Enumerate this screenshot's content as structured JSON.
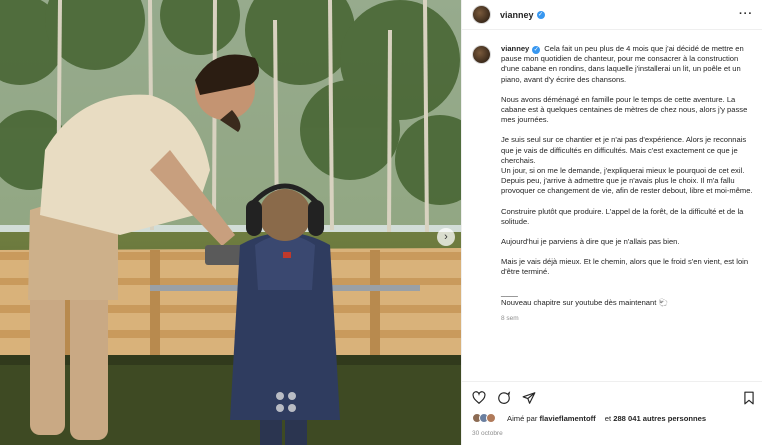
{
  "post": {
    "username": "vianney",
    "verified": true,
    "more_icon": "···",
    "caption_paragraphs": [
      "Cela fait un peu plus de 4 mois que j'ai décidé de mettre en pause mon quotidien de chanteur, pour me consacrer à la construction d'une cabane en rondins, dans laquelle j'installerai un lit, un poêle et un piano, avant d'y écrire des chansons.",
      "Nous avons déménagé en famille pour le temps de cette aventure. La cabane est à quelques centaines de mètres de chez nous, alors j'y passe mes journées.",
      "Je suis seul sur ce chantier et je n'ai pas d'expérience. Alors je reconnais que je vais de difficultés en difficultés. Mais c'est exactement ce que je cherchais.\nUn jour, si on me le demande, j'expliquerai mieux le pourquoi de cet exil.\nDepuis peu, j'arrive à admettre que je n'avais plus le choix. Il m'a fallu provoquer ce changement de vie, afin de rester debout, libre et moi-même.",
      "Construire plutôt que produire. L'appel de la forêt, de la difficulté et de la solitude.",
      "Aujourd'hui je parviens à dire que je n'allais pas bien.",
      "Mais je vais déjà mieux. Et le chemin, alors que le froid s'en vient, est loin d'être terminé.",
      "____\nNouveau chapitre sur youtube dès maintenant 🐑"
    ],
    "caption_time": "8 sem",
    "liked_by_prefix": "Aimé par",
    "liked_by_user": "flavieflamentoff",
    "liked_by_joiner": "et",
    "liked_by_count": "288 041 autres personnes",
    "date": "30 octobre"
  },
  "icons": {
    "like": "heart-icon",
    "comment": "comment-icon",
    "share": "share-icon",
    "save": "bookmark-icon",
    "next": "chevron-right-icon"
  },
  "colors": {
    "verified": "#3897f0",
    "text": "#262626",
    "muted": "#8e8e8e"
  }
}
